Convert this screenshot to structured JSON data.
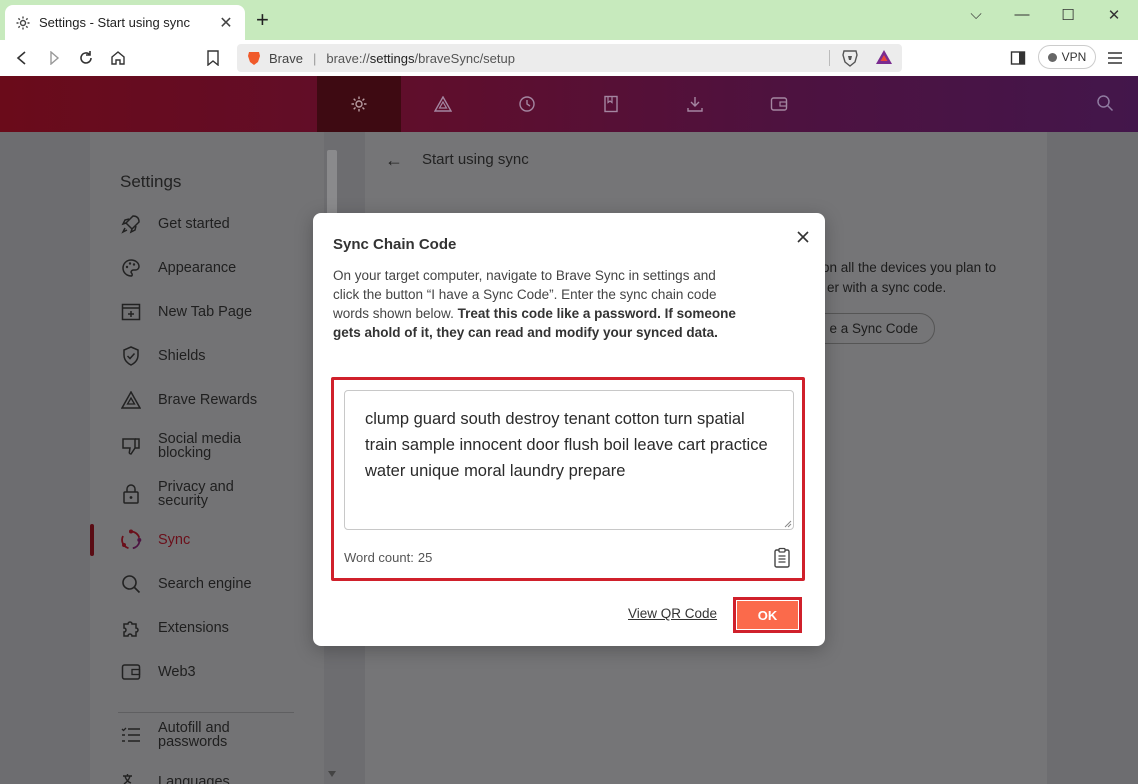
{
  "browser": {
    "tab_title": "Settings - Start using sync",
    "tab_close": "✕",
    "new_tab": "+",
    "window_controls": [
      "⌵",
      "—",
      "☐",
      "✕"
    ],
    "omnibox": {
      "brand": "Brave",
      "separator": "|",
      "url_prefix": "brave://",
      "url_host": "settings",
      "url_path": "/braveSync/setup"
    },
    "vpn_label": "VPN"
  },
  "settings_header": {
    "icons": [
      "settings-gear-icon",
      "rewards-triangle-icon",
      "history-icon",
      "bookmarks-icon",
      "downloads-icon",
      "wallet-icon"
    ],
    "active_index": 0
  },
  "sidebar": {
    "title": "Settings",
    "items": [
      {
        "label": "Get started",
        "icon": "rocket-icon"
      },
      {
        "label": "Appearance",
        "icon": "palette-icon"
      },
      {
        "label": "New Tab Page",
        "icon": "new-tab-icon"
      },
      {
        "label": "Shields",
        "icon": "shield-icon"
      },
      {
        "label": "Brave Rewards",
        "icon": "rewards-icon"
      },
      {
        "label": "Social media\nblocking",
        "icon": "thumbs-down-icon"
      },
      {
        "label": "Privacy and\nsecurity",
        "icon": "lock-icon"
      },
      {
        "label": "Sync",
        "icon": "sync-icon",
        "active": true
      },
      {
        "label": "Search engine",
        "icon": "search-icon"
      },
      {
        "label": "Extensions",
        "icon": "puzzle-icon"
      },
      {
        "label": "Web3",
        "icon": "wallet-icon"
      },
      {
        "label": "Autofill and\npasswords",
        "icon": "list-icon"
      },
      {
        "label": "Languages",
        "icon": "language-icon"
      }
    ]
  },
  "content": {
    "title": "Start using sync",
    "bg_line1": "on all the devices you plan to",
    "bg_line2": "er with a sync code.",
    "bg_button": "e a Sync Code"
  },
  "dialog": {
    "title": "Sync Chain Code",
    "desc_plain": "On your target computer, navigate to Brave Sync in settings and click the button “I have a Sync Code”. Enter the sync chain code words shown below. ",
    "desc_bold": "Treat this code like a password. If someone gets ahold of it, they can read and modify your synced data.",
    "code_words": "clump guard south destroy tenant cotton turn spatial train sample innocent door flush boil leave cart practice water unique moral laundry prepare",
    "word_count_label": "Word count:",
    "word_count": "25",
    "view_qr_label": "View QR Code",
    "ok_label": "OK"
  },
  "colors": {
    "highlight": "#d0202b",
    "ok_button": "#fb6a4b",
    "header_start": "#6a0b1a",
    "header_end": "#43164b"
  }
}
